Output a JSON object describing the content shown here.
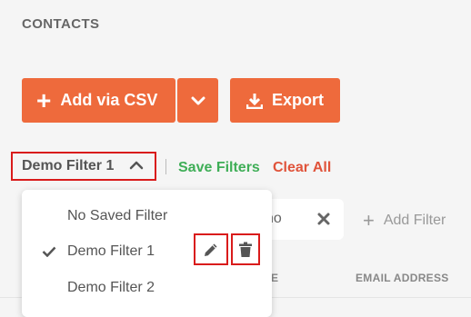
{
  "page": {
    "title": "CONTACTS"
  },
  "toolbar": {
    "add_csv_label": "Add via CSV",
    "export_label": "Export"
  },
  "filters": {
    "selected": "Demo Filter 1",
    "save_label": "Save Filters",
    "clear_label": "Clear All",
    "chip_text": "no",
    "add_filter_label": "Add Filter"
  },
  "dropdown": {
    "options": [
      {
        "label": "No Saved Filter",
        "checked": false
      },
      {
        "label": "Demo Filter 1",
        "checked": true
      },
      {
        "label": "Demo Filter 2",
        "checked": false
      }
    ]
  },
  "table": {
    "columns": [
      "E",
      "EMAIL ADDRESS"
    ]
  },
  "colors": {
    "accent": "#ee6a3c",
    "save_green": "#3fae57",
    "clear_red": "#e0533a",
    "highlight_border": "#d91b1b"
  },
  "icons": [
    "plus-icon",
    "chevron-down-icon",
    "download-icon",
    "chevron-up-icon",
    "close-icon",
    "check-icon",
    "pencil-icon",
    "trash-icon"
  ]
}
